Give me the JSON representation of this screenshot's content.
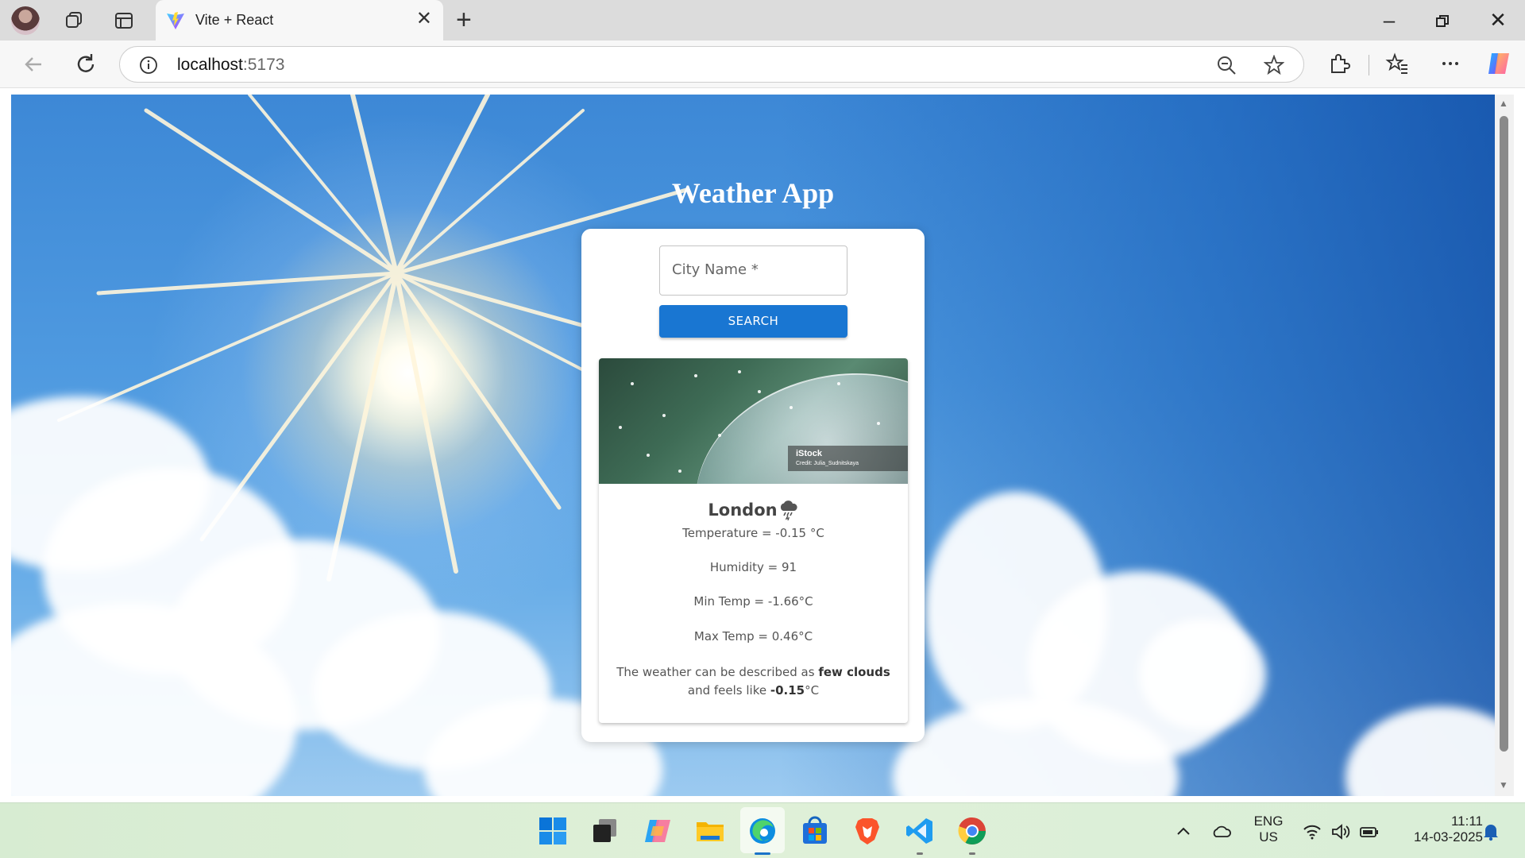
{
  "browser": {
    "tab_title": "Vite + React",
    "url_host": "localhost",
    "url_port": ":5173"
  },
  "page": {
    "app_title": "Weather App",
    "city_field_label": "City Name *",
    "search_label": "SEARCH",
    "image_watermark": "iStock",
    "image_credit": "Credit: Julia_Sudnitskaya",
    "city": "London",
    "weather_icon": "thunderstorm-icon",
    "temperature": "Temperature = -0.15 °C",
    "humidity": "Humidity = 91",
    "min_temp": "Min Temp = -1.66°C",
    "max_temp": "Max Temp = 0.46°C",
    "desc_prefix": "The weather can be described as ",
    "desc_condition": "few clouds",
    "desc_middle": " and feels like ",
    "desc_feels": "-0.15",
    "desc_suffix": "°C"
  },
  "taskbar": {
    "apps": [
      "windows-start-icon",
      "task-view-icon",
      "copilot-icon",
      "file-explorer-icon",
      "edge-icon",
      "microsoft-store-icon",
      "brave-icon",
      "vscode-icon",
      "chrome-icon"
    ],
    "lang_line1": "ENG",
    "lang_line2": "US",
    "time": "11:11",
    "date": "14-03-2025"
  },
  "colors": {
    "search_button": "#1976d2",
    "taskbar": "#dff0d8",
    "active_indicator": "#1a73c8"
  }
}
